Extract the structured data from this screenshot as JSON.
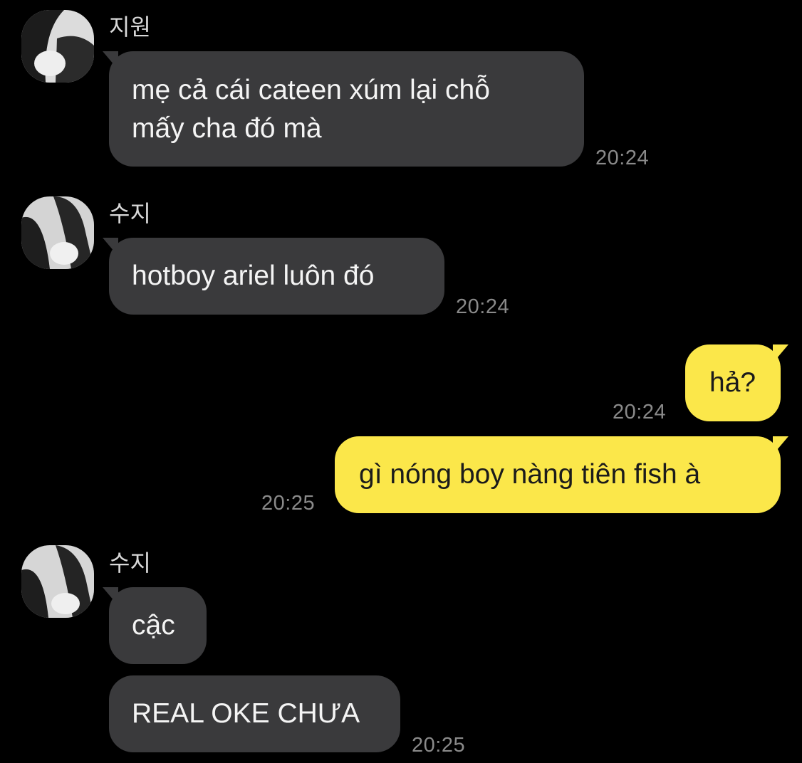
{
  "messages": [
    {
      "sender": "지원",
      "text_line1": "mẹ cả cái cateen xúm lại chỗ",
      "text_line2": "mấy cha đó mà",
      "time": "20:24"
    },
    {
      "sender": "수지",
      "text": "hotboy ariel luôn đó",
      "time": "20:24"
    },
    {
      "text": "hả?",
      "time": "20:24"
    },
    {
      "text": "gì nóng boy nàng tiên fish à",
      "time": "20:25"
    },
    {
      "sender": "수지",
      "text1": "cậc",
      "text2": "REAL OKE CHƯA",
      "time": "20:25"
    }
  ],
  "colors": {
    "background": "#000000",
    "incoming_bubble": "#3a3a3c",
    "outgoing_bubble": "#fbe74a",
    "timestamp": "#8a8a8a"
  },
  "icons": {
    "avatar": "profile-photo"
  }
}
